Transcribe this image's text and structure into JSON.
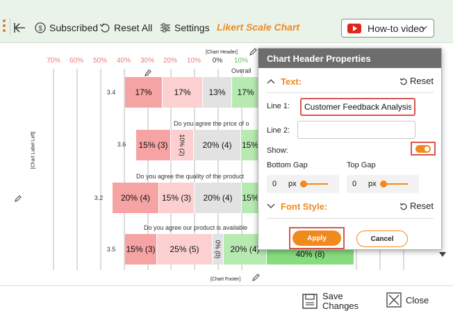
{
  "toolbar": {
    "back_label": "",
    "subscribed_label": "Subscribed",
    "reset_all_label": "Reset All",
    "settings_label": "Settings",
    "title": "Likert Scale Chart",
    "howto_label": "How-to video",
    "accent_color": "#f08a1c"
  },
  "chart_data": {
    "type": "bar",
    "orientation": "diverging-horizontal",
    "x_tick_labels": [
      "70%",
      "60%",
      "50%",
      "40%",
      "30%",
      "20%",
      "10%",
      "0%",
      "10%"
    ],
    "header_tag": "[Chart Header]",
    "footer_tag": "[Chart Footer]",
    "left_tag": "[Chart Label Left]",
    "rows": [
      {
        "label": "Overall",
        "mean": "3.4",
        "segments": [
          "17%",
          "17%",
          "13%",
          "17%"
        ]
      },
      {
        "label": "Do you agree the price of o",
        "mean": "3.6",
        "segments": [
          "15% (3)",
          "10% (2)",
          "20% (4)",
          "15%"
        ]
      },
      {
        "label": "Do you agree the quality of the product",
        "mean": "3.2",
        "segments": [
          "20% (4)",
          "15% (3)",
          "20% (4)",
          "15%"
        ]
      },
      {
        "label": "Do you agree our product is available",
        "mean": "3.5",
        "segments": [
          "15% (3)",
          "25% (5)",
          "0% (0)",
          "20% (4)",
          "40% (8)"
        ]
      }
    ],
    "colors": [
      "#f6a3a3",
      "#fcd0d0",
      "#e2e2e2",
      "#b7eab1",
      "#86dc7e"
    ]
  },
  "panel": {
    "title": "Chart Header Properties",
    "text_section": "Text:",
    "reset_label": "Reset",
    "line1_label": "Line 1:",
    "line1_value": "Customer Feedback Analysis",
    "line2_label": "Line 2:",
    "line2_value": "",
    "show_label": "Show:",
    "show_on": true,
    "bottom_gap_label": "Bottom Gap",
    "bottom_gap_value": "0",
    "top_gap_label": "Top Gap",
    "top_gap_value": "0",
    "unit": "px",
    "font_section": "Font Style:",
    "apply_label": "Apply",
    "cancel_label": "Cancel"
  },
  "footer": {
    "save_label_1": "Save",
    "save_label_2": "Changes",
    "close_label": "Close"
  }
}
